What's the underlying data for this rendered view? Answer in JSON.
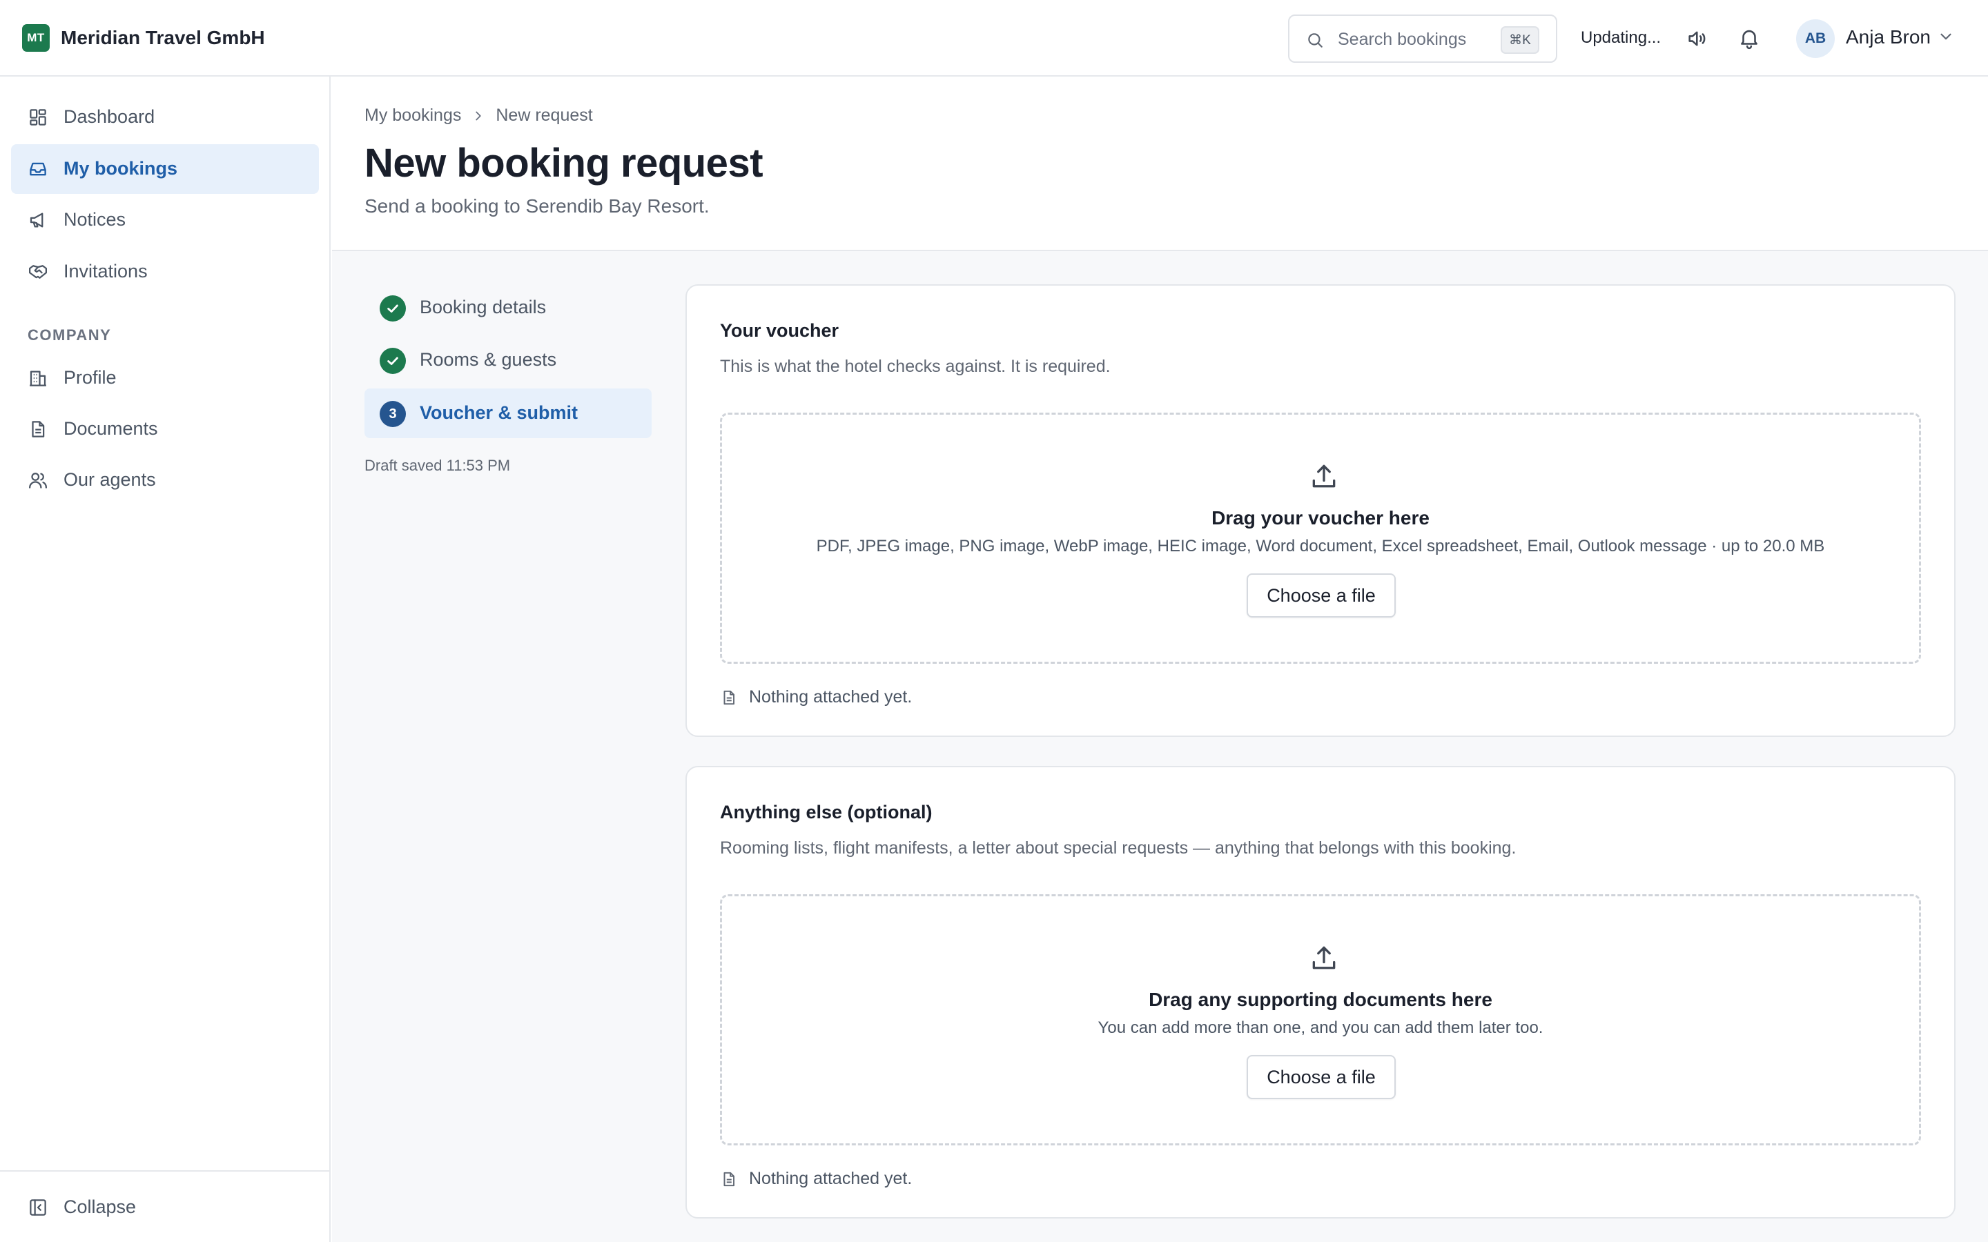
{
  "app": {
    "brand_initials": "MT",
    "brand_name": "Meridian Travel GmbH",
    "brand_color": "#1c7a4e"
  },
  "topbar": {
    "search_placeholder": "Search bookings",
    "search_shortcut": "⌘K",
    "status": "Updating...",
    "user_initials": "AB",
    "user_name": "Anja Bron",
    "icons": [
      "search-icon",
      "speaker-icon",
      "bell-icon",
      "chevron-down-icon"
    ]
  },
  "sidebar": {
    "items": [
      {
        "label": "Dashboard",
        "icon": "dashboard-icon",
        "active": false
      },
      {
        "label": "My bookings",
        "icon": "inbox-icon",
        "active": true
      },
      {
        "label": "Notices",
        "icon": "megaphone-icon",
        "active": false
      },
      {
        "label": "Invitations",
        "icon": "handshake-icon",
        "active": false
      }
    ],
    "section_label": "COMPANY",
    "company_items": [
      {
        "label": "Profile",
        "icon": "building-icon"
      },
      {
        "label": "Documents",
        "icon": "document-icon"
      },
      {
        "label": "Our agents",
        "icon": "users-icon"
      }
    ],
    "collapse_label": "Collapse"
  },
  "header": {
    "breadcrumb": [
      "My bookings",
      "New request"
    ],
    "title": "New booking request",
    "subtitle": "Send a booking to Serendib Bay Resort."
  },
  "steps": [
    {
      "label": "Booking details",
      "state": "done"
    },
    {
      "label": "Rooms & guests",
      "state": "done"
    },
    {
      "label": "Voucher & submit",
      "state": "current",
      "number": "3"
    }
  ],
  "draft_status": "Draft saved 11:53 PM",
  "voucher_card": {
    "title": "Your voucher",
    "description": "This is what the hotel checks against. It is required.",
    "drop_title": "Drag your voucher here",
    "drop_hint": "PDF, JPEG image, PNG image, WebP image, HEIC image, Word document, Excel spreadsheet, Email, Outlook message · up to 20.0 MB",
    "button": "Choose a file",
    "attached": "Nothing attached yet."
  },
  "extra_card": {
    "title": "Anything else (optional)",
    "description": "Rooming lists, flight manifests, a letter about special requests — anything that belongs with this booking.",
    "drop_title": "Drag any supporting documents here",
    "drop_hint": "You can add more than one, and you can add them later too.",
    "button": "Choose a file",
    "attached": "Nothing attached yet."
  },
  "colors": {
    "accent": "#1f5ea8",
    "active_bg": "#e7f0fb",
    "success": "#1c7a4e"
  }
}
